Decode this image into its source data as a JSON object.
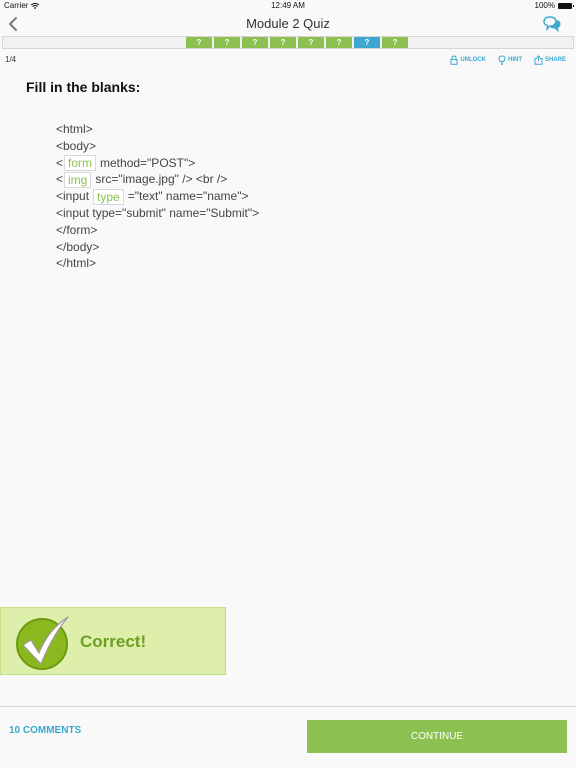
{
  "status_bar": {
    "carrier": "Carrier",
    "time": "12:49 AM",
    "battery": "100%"
  },
  "nav": {
    "title": "Module 2 Quiz",
    "back_icon": "chevron-left-icon",
    "chat_icon": "chat-bubbles-icon"
  },
  "progress": {
    "boxes": [
      {
        "label": "?",
        "state": "answered"
      },
      {
        "label": "?",
        "state": "answered"
      },
      {
        "label": "?",
        "state": "answered"
      },
      {
        "label": "?",
        "state": "answered"
      },
      {
        "label": "?",
        "state": "answered"
      },
      {
        "label": "?",
        "state": "answered"
      },
      {
        "label": "?",
        "state": "current"
      },
      {
        "label": "?",
        "state": "answered"
      }
    ],
    "colors": {
      "answered": "#8cc152",
      "current": "#3da7d1"
    }
  },
  "question": {
    "counter": "1/4",
    "title": "Fill in the blanks:",
    "actions": {
      "unlock": "UNLOCK",
      "hint": "HINT",
      "share": "SHARE"
    }
  },
  "code": {
    "l1": "<html>",
    "l2": "<body>",
    "l3_pre": "<",
    "l3_blank": "form",
    "l3_post": "method=\"POST\">",
    "l4_pre": "<",
    "l4_blank": "img",
    "l4_post": "src=\"image.jpg\" /> <br />",
    "l5_pre": "<input",
    "l5_blank": "type",
    "l5_post": "=\"text\" name=\"name\">",
    "l6": "<input type=\"submit\" name=\"Submit\">",
    "l7": "</form>",
    "l8": "</body>",
    "l9": "</html>"
  },
  "feedback": {
    "text": "Correct!",
    "icon": "checkmark-icon",
    "color": "#6e9f20"
  },
  "footer": {
    "comments": "10 COMMENTS",
    "continue": "CONTINUE"
  }
}
